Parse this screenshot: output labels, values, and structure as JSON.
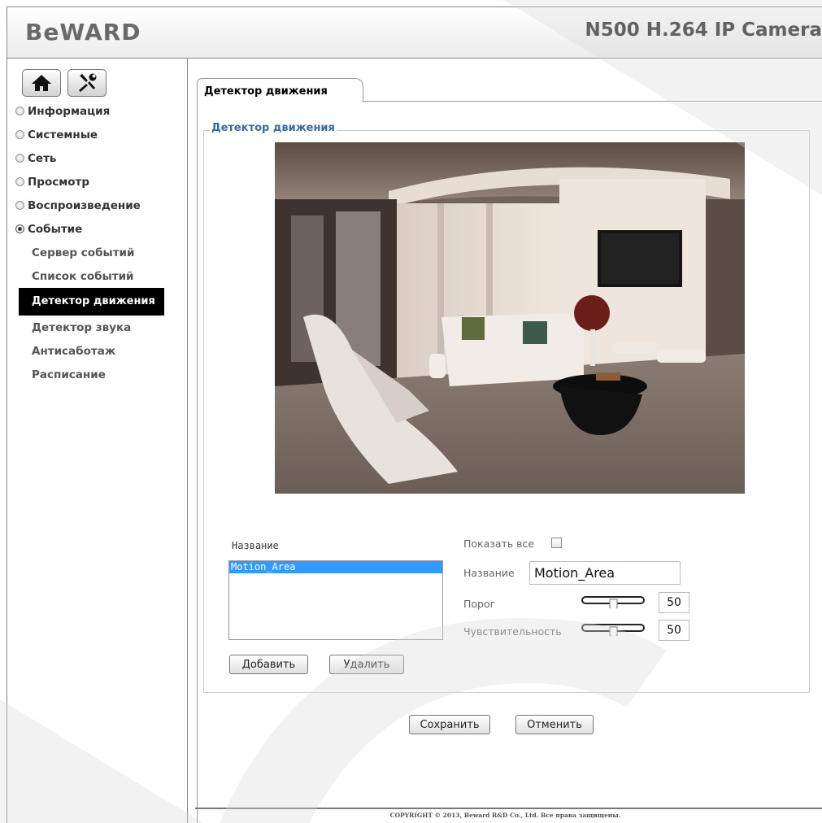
{
  "header": {
    "logo": "BeWARD",
    "product": "N500 H.264 IP Camera"
  },
  "sidebar": {
    "top_buttons": [
      {
        "icon": "home-icon"
      },
      {
        "icon": "tools-icon"
      }
    ],
    "menu": [
      {
        "label": "Информация"
      },
      {
        "label": "Системные"
      },
      {
        "label": "Сеть"
      },
      {
        "label": "Просмотр"
      },
      {
        "label": "Воспроизведение"
      },
      {
        "label": "Событие",
        "expanded": true
      }
    ],
    "submenu": [
      {
        "label": "Сервер событий"
      },
      {
        "label": "Список событий"
      },
      {
        "label": "Детектор движения",
        "active": true
      },
      {
        "label": "Детектор звука"
      },
      {
        "label": "Антисаботаж"
      },
      {
        "label": "Расписание"
      }
    ]
  },
  "main": {
    "tab": "Детектор движения",
    "section_title": "Детектор движения",
    "areas_label": "Название",
    "areas": [
      "Motion_Area"
    ],
    "add_button": "Добавить",
    "delete_button": "Удалить",
    "show_all_label": "Показать все",
    "show_all_checked": false,
    "name_label": "Название",
    "name_value": "Motion_Area",
    "threshold_label": "Порог",
    "threshold_value": "50",
    "sensitivity_label": "Чувствительность",
    "sensitivity_value": "50",
    "save_button": "Сохранить",
    "cancel_button": "Отменить"
  },
  "footer": {
    "copyright": "COPYRIGHT © 2013, Beward R&D Co., Ltd. Все права защищены."
  },
  "colors": {
    "accent": "#3a6aa5",
    "selection": "#3399ff",
    "active_menu_bg": "#000000"
  }
}
